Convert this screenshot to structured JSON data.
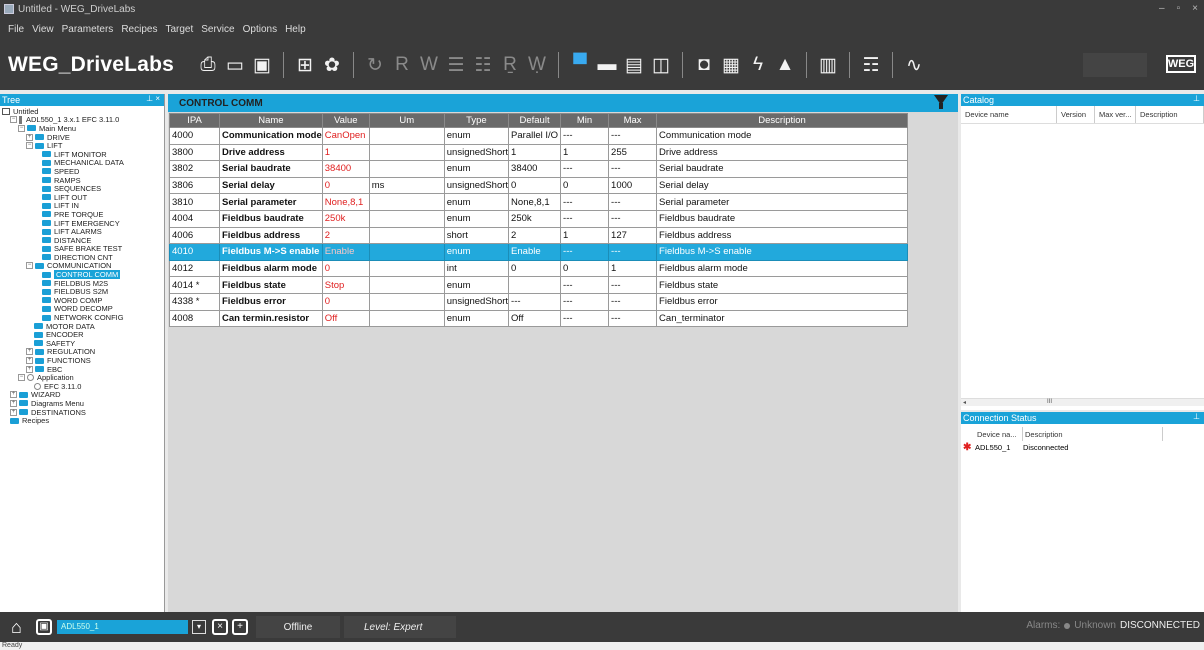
{
  "window": {
    "title": "Untitled - WEG_DriveLabs",
    "controls": [
      "–",
      "▫",
      "×"
    ]
  },
  "menu": [
    "File",
    "View",
    "Parameters",
    "Recipes",
    "Target",
    "Service",
    "Options",
    "Help"
  ],
  "brand": "WEG_DriveLabs",
  "logo": "WEG",
  "tree": {
    "title": "Tree",
    "pin": "⊥ ×",
    "items": [
      {
        "label": "Untitled",
        "indent": 0,
        "icon": "doc",
        "ex": ""
      },
      {
        "label": "ADL550_1  3.x.1 EFC 3.11.0",
        "indent": 1,
        "icon": "bar",
        "ex": "−"
      },
      {
        "label": "Main Menu",
        "indent": 2,
        "icon": "fold",
        "ex": "−"
      },
      {
        "label": "DRIVE",
        "indent": 3,
        "icon": "fold",
        "ex": "+"
      },
      {
        "label": "LIFT",
        "indent": 3,
        "icon": "fold",
        "ex": "−"
      },
      {
        "label": "LIFT MONITOR",
        "indent": 5,
        "icon": "fold",
        "ex": ""
      },
      {
        "label": "MECHANICAL DATA",
        "indent": 5,
        "icon": "fold",
        "ex": ""
      },
      {
        "label": "SPEED",
        "indent": 5,
        "icon": "fold",
        "ex": ""
      },
      {
        "label": "RAMPS",
        "indent": 5,
        "icon": "fold",
        "ex": ""
      },
      {
        "label": "SEQUENCES",
        "indent": 5,
        "icon": "fold",
        "ex": ""
      },
      {
        "label": "LIFT OUT",
        "indent": 5,
        "icon": "fold",
        "ex": ""
      },
      {
        "label": "LIFT IN",
        "indent": 5,
        "icon": "fold",
        "ex": ""
      },
      {
        "label": "PRE TORQUE",
        "indent": 5,
        "icon": "fold",
        "ex": ""
      },
      {
        "label": "LIFT EMERGENCY",
        "indent": 5,
        "icon": "fold",
        "ex": ""
      },
      {
        "label": "LIFT ALARMS",
        "indent": 5,
        "icon": "fold",
        "ex": ""
      },
      {
        "label": "DISTANCE",
        "indent": 5,
        "icon": "fold",
        "ex": ""
      },
      {
        "label": "SAFE BRAKE TEST",
        "indent": 5,
        "icon": "fold",
        "ex": ""
      },
      {
        "label": "DIRECTION CNT",
        "indent": 5,
        "icon": "fold",
        "ex": ""
      },
      {
        "label": "COMMUNICATION",
        "indent": 3,
        "icon": "fold",
        "ex": "−"
      },
      {
        "label": "CONTROL COMM",
        "indent": 5,
        "icon": "fold",
        "ex": "",
        "selected": true
      },
      {
        "label": "FIELDBUS M2S",
        "indent": 5,
        "icon": "fold",
        "ex": ""
      },
      {
        "label": "FIELDBUS S2M",
        "indent": 5,
        "icon": "fold",
        "ex": ""
      },
      {
        "label": "WORD COMP",
        "indent": 5,
        "icon": "fold",
        "ex": ""
      },
      {
        "label": "WORD DECOMP",
        "indent": 5,
        "icon": "fold",
        "ex": ""
      },
      {
        "label": "NETWORK CONFIG",
        "indent": 5,
        "icon": "fold",
        "ex": ""
      },
      {
        "label": "MOTOR DATA",
        "indent": 4,
        "icon": "fold",
        "ex": ""
      },
      {
        "label": "ENCODER",
        "indent": 4,
        "icon": "fold",
        "ex": ""
      },
      {
        "label": "SAFETY",
        "indent": 4,
        "icon": "fold",
        "ex": ""
      },
      {
        "label": "REGULATION",
        "indent": 3,
        "icon": "fold",
        "ex": "+"
      },
      {
        "label": "FUNCTIONS",
        "indent": 3,
        "icon": "fold",
        "ex": "+"
      },
      {
        "label": "EBC",
        "indent": 3,
        "icon": "fold",
        "ex": "+"
      },
      {
        "label": "Application",
        "indent": 2,
        "icon": "dot",
        "ex": "−"
      },
      {
        "label": "EFC 3.11.0",
        "indent": 4,
        "icon": "dot",
        "ex": ""
      },
      {
        "label": "WIZARD",
        "indent": 1,
        "icon": "fold",
        "ex": "+"
      },
      {
        "label": "Diagrams Menu",
        "indent": 1,
        "icon": "fold",
        "ex": "+"
      },
      {
        "label": "DESTINATIONS",
        "indent": 1,
        "icon": "fold",
        "ex": "+"
      },
      {
        "label": "Recipes",
        "indent": 1,
        "icon": "fold",
        "ex": ""
      }
    ]
  },
  "main": {
    "title": "CONTROL COMM",
    "columns": [
      "IPA",
      "Name",
      "Value",
      "Um",
      "Type",
      "Default",
      "Min",
      "Max",
      "Description"
    ],
    "rows": [
      [
        "4000",
        "Communication mode",
        "CanOpen",
        "",
        "enum",
        "Parallel I/O",
        "---",
        "---",
        "Communication mode"
      ],
      [
        "3800",
        "Drive address",
        "1",
        "",
        "unsignedShort",
        "1",
        "1",
        "255",
        "Drive address"
      ],
      [
        "3802",
        "Serial baudrate",
        "38400",
        "",
        "enum",
        "38400",
        "---",
        "---",
        "Serial baudrate"
      ],
      [
        "3806",
        "Serial delay",
        "0",
        "ms",
        "unsignedShort",
        "0",
        "0",
        "1000",
        "Serial delay"
      ],
      [
        "3810",
        "Serial parameter",
        "None,8,1",
        "",
        "enum",
        "None,8,1",
        "---",
        "---",
        "Serial parameter"
      ],
      [
        "4004",
        "Fieldbus baudrate",
        "250k",
        "",
        "enum",
        "250k",
        "---",
        "---",
        "Fieldbus baudrate"
      ],
      [
        "4006",
        "Fieldbus address",
        "2",
        "",
        "short",
        "2",
        "1",
        "127",
        "Fieldbus address"
      ],
      [
        "4010",
        "Fieldbus M->S enable",
        "Enable",
        "",
        "enum",
        "Enable",
        "---",
        "---",
        "Fieldbus M->S enable"
      ],
      [
        "4012",
        "Fieldbus alarm mode",
        "0",
        "",
        "int",
        "0",
        "0",
        "1",
        "Fieldbus alarm mode"
      ],
      [
        "4014 *",
        "Fieldbus state",
        "Stop",
        "",
        "enum",
        "",
        "---",
        "---",
        "Fieldbus state"
      ],
      [
        "4338 *",
        "Fieldbus error",
        "0",
        "",
        "unsignedShort",
        "---",
        "---",
        "---",
        "Fieldbus error"
      ],
      [
        "4008",
        "Can termin.resistor",
        "Off",
        "",
        "enum",
        "Off",
        "---",
        "---",
        "Can_terminator"
      ]
    ],
    "selected_row": 7
  },
  "catalog": {
    "title": "Catalog",
    "columns": [
      "Device name",
      "Version",
      "Max ver...",
      "Description"
    ],
    "scroll_mark": "III"
  },
  "connection": {
    "title": "Connection Status",
    "columns": [
      "Device na...",
      "Description"
    ],
    "rows": [
      {
        "device": "ADL550_1",
        "status": "Disconnected"
      }
    ]
  },
  "statusbar": {
    "device": "ADL550_1",
    "mode": "Offline",
    "level": "Level: Expert",
    "alarms_label": "Alarms:",
    "alarms_value": "Unknown",
    "connection": "DISCONNECTED"
  },
  "ready": "Ready",
  "colors": {
    "accent": "#1aa3d8",
    "value_red": "#e02020",
    "dark_bg": "#3a3a3a"
  }
}
